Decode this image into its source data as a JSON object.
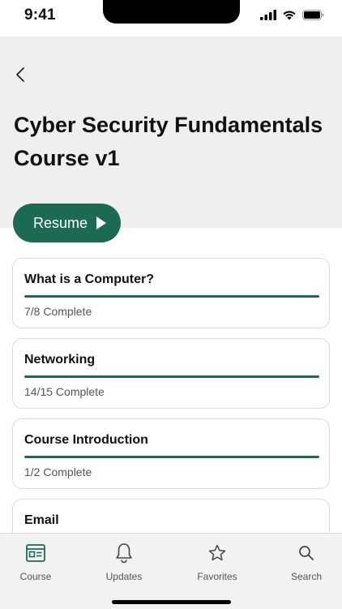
{
  "status_bar": {
    "time": "9:41"
  },
  "header": {
    "title": "Cyber Security Fundamentals Course v1"
  },
  "resume": {
    "label": "Resume"
  },
  "modules": [
    {
      "title": "What is a Computer?",
      "progress_text": "7/8 Complete",
      "progress": 1.0
    },
    {
      "title": "Networking",
      "progress_text": "14/15 Complete",
      "progress": 1.0
    },
    {
      "title": "Course Introduction",
      "progress_text": "1/2 Complete",
      "progress": 1.0
    },
    {
      "title": "Email",
      "progress_text": "",
      "progress": 0
    }
  ],
  "tab_bar": {
    "tabs": [
      {
        "label": "Course",
        "icon": "course-icon"
      },
      {
        "label": "Updates",
        "icon": "bell-icon"
      },
      {
        "label": "Favorites",
        "icon": "star-icon"
      },
      {
        "label": "Search",
        "icon": "search-icon"
      }
    ]
  },
  "colors": {
    "accent": "#1d6a53",
    "header_bg": "#efefef",
    "tab_bg": "#f2f2f2"
  }
}
